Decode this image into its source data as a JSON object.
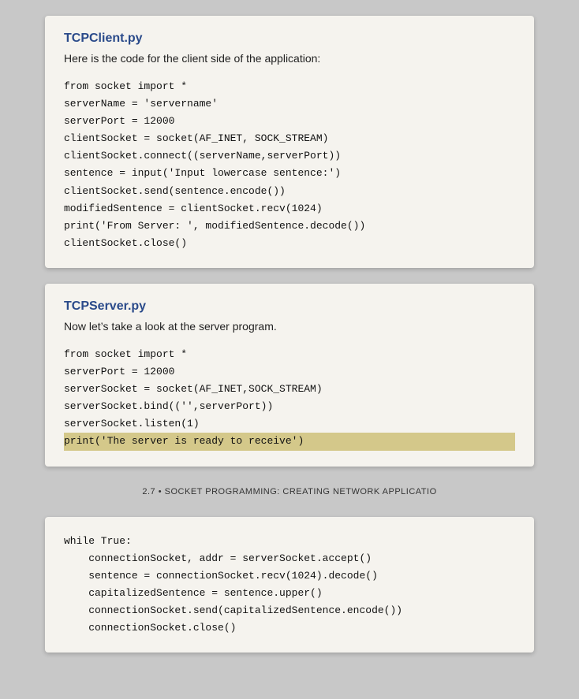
{
  "card1": {
    "title": "TCPClient.py",
    "description": "Here is the code for the client side of the application:",
    "code": [
      "from socket import *",
      "serverName = 'servername'",
      "serverPort = 12000",
      "clientSocket = socket(AF_INET, SOCK_STREAM)",
      "clientSocket.connect((serverName,serverPort))",
      "sentence = input('Input lowercase sentence:')",
      "clientSocket.send(sentence.encode())",
      "modifiedSentence = clientSocket.recv(1024)",
      "print('From Server: ', modifiedSentence.decode())",
      "clientSocket.close()"
    ]
  },
  "card2": {
    "title": "TCPServer.py",
    "description": "Now let’s take a look at the server program.",
    "code_top": [
      "from socket import *",
      "serverPort = 12000",
      "serverSocket = socket(AF_INET,SOCK_STREAM)",
      "serverSocket.bind(('',serverPort))",
      "serverSocket.listen(1)",
      "print('The server is ready to receive')"
    ],
    "highlight_line": "print('The server is ready to receive')"
  },
  "footer": {
    "page_number": "2.7",
    "bullet": "•",
    "text": "SOCKET PROGRAMMING: CREATING NETWORK APPLICATIO"
  },
  "card3": {
    "code": [
      "while True:",
      "    connectionSocket, addr = serverSocket.accept()",
      "    sentence = connectionSocket.recv(1024).decode()",
      "    capitalizedSentence = sentence.upper()",
      "    connectionSocket.send(capitalizedSentence.encode())",
      "    connectionSocket.close()"
    ]
  }
}
